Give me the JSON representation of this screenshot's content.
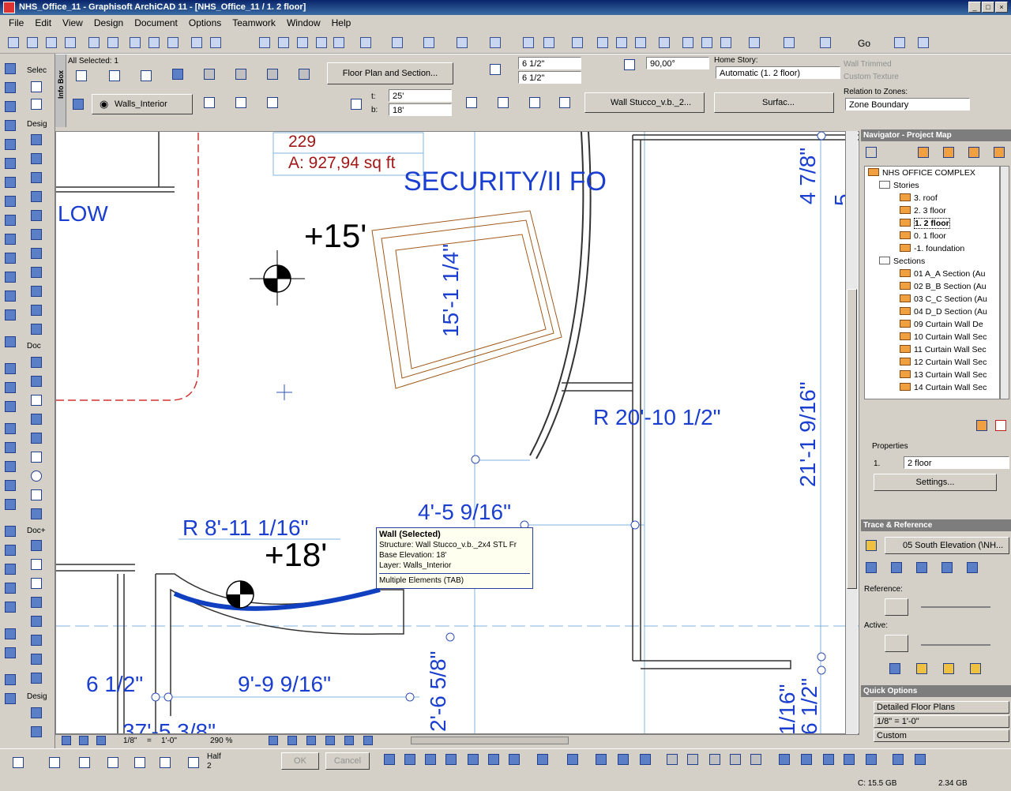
{
  "window": {
    "title": "NHS_Office_11 - Graphisoft ArchiCAD 11 - [NHS_Office_11 / 1. 2 floor]"
  },
  "menu": [
    "File",
    "Edit",
    "View",
    "Design",
    "Document",
    "Options",
    "Teamwork",
    "Window",
    "Help"
  ],
  "toolbar": {
    "go_label": "Go"
  },
  "toolbox": {
    "select_label": "Selec",
    "design_label": "Desig",
    "doc_label": "Doc",
    "docplus_label": "Doc+",
    "design2_label": "Desig"
  },
  "infobox": {
    "side_label": "Info Box",
    "all_selected": "All Selected: 1",
    "floor_plan_btn": "Floor Plan and Section...",
    "layer": "Walls_Interior",
    "thickness_top": "6 1/2\"",
    "thickness_bottom": "6 1/2\"",
    "t_label": "t:",
    "b_label": "b:",
    "t_value": "25'",
    "b_value": "18'",
    "angle": "90,00°",
    "composite": "Wall Stucco_v.b._2...",
    "surface": "Surfac...",
    "home_story_label": "Home Story:",
    "home_story_value": "Automatic (1. 2 floor)",
    "wall_trimmed": "Wall Trimmed",
    "custom_texture": "Custom Texture",
    "relation_label": "Relation to Zones:",
    "relation_value": "Zone Boundary"
  },
  "canvas": {
    "zone_number": "229",
    "zone_area": "A: 927,94 sq ft",
    "security_text": "SECURITY/II FO",
    "low_text": "LOW",
    "elev_15": "+15'",
    "elev_18": "+18'",
    "dim_15": "15'-1 1/4\"",
    "dim_r20": "R 20'-10 1/2\"",
    "dim_4_5": "4'-5 9/16\"",
    "dim_r8": "R 8'-11 1/16\"",
    "dim_6_half": "6 1/2\"",
    "dim_9_9": "9'-9 9/16\"",
    "dim_2_6": "2'-6 5/8\"",
    "dim_21_1": "21'-1 9/16\"",
    "dim_4_7": "4 7/8\"",
    "dim_6_half_v": "6 1/2\"",
    "dim_1_16": "1/16\"",
    "dim_37": "37'-5 3/8\"",
    "dim_5": "5"
  },
  "tooltip": {
    "title": "Wall (Selected)",
    "structure": "Structure: Wall Stucco_v.b._2x4 STL Fr",
    "base": "Base Elevation: 18'",
    "layer": "Layer: Walls_Interior",
    "footer": "Multiple Elements (TAB)"
  },
  "viewbar": {
    "scale_a": "1/8\"",
    "scale_eq": "=",
    "scale_b": "1'-0\"",
    "zoom": "290 %"
  },
  "navigator": {
    "header": "Navigator - Project Map",
    "root": "NHS OFFICE COMPLEX",
    "stories_label": "Stories",
    "stories": [
      "3. roof",
      "2. 3 floor",
      "1. 2 floor",
      "0. 1 floor",
      "-1. foundation"
    ],
    "sections_label": "Sections",
    "sections": [
      "01 A_A Section (Au",
      "02 B_B Section (Au",
      "03 C_C Section (Au",
      "04 D_D Section (Au",
      "09 Curtain Wall De",
      "10 Curtain Wall Sec",
      "11 Curtain Wall Sec",
      "12 Curtain Wall Sec",
      "13 Curtain Wall Sec",
      "14 Curtain Wall Sec"
    ],
    "properties_label": "Properties",
    "prop_num": "1.",
    "prop_name": "2 floor",
    "settings_btn": "Settings..."
  },
  "trace": {
    "header": "Trace & Reference",
    "source": "05 South Elevation (\\NH...",
    "reference_label": "Reference:",
    "active_label": "Active:"
  },
  "quick_options": {
    "header": "Quick Options",
    "plan": "Detailed Floor Plans",
    "scale_a": "1/8\"",
    "scale_eq": "=",
    "scale_b": "1'-0\"",
    "custom": "Custom"
  },
  "statusbar": {
    "half_label": "Half",
    "half_value": "2",
    "ok": "OK",
    "cancel": "Cancel",
    "disk_c": "C: 15.5 GB",
    "disk_mem": "2.34 GB"
  }
}
